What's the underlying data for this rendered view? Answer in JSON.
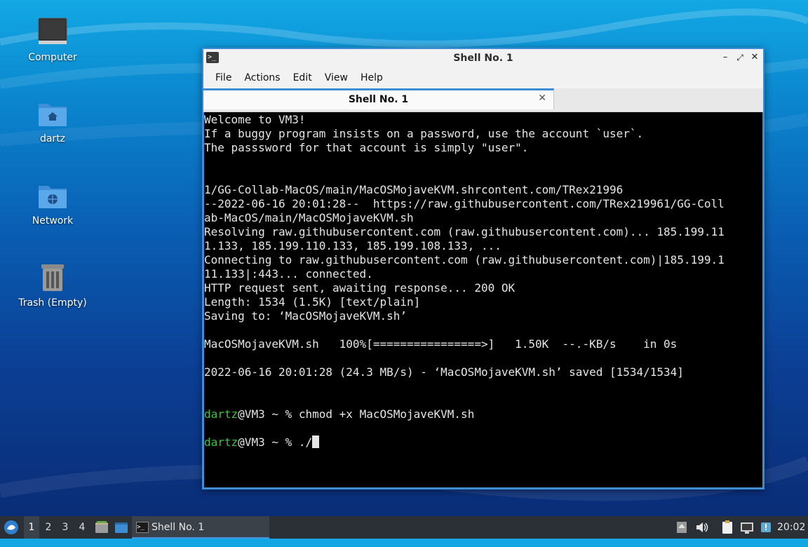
{
  "desktop": {
    "icons": [
      {
        "label": "Computer",
        "icon": "computer-icon"
      },
      {
        "label": "dartz",
        "icon": "home-folder-icon"
      },
      {
        "label": "Network",
        "icon": "network-folder-icon"
      },
      {
        "label": "Trash (Empty)",
        "icon": "trash-icon"
      }
    ]
  },
  "window": {
    "title": "Shell No. 1",
    "icon": "terminal-icon",
    "controls": [
      "minimize",
      "maximize",
      "close"
    ],
    "accent_color": "#3d8cd4"
  },
  "menubar": {
    "items": [
      "File",
      "Actions",
      "Edit",
      "View",
      "Help"
    ]
  },
  "tabs": [
    {
      "label": "Shell No. 1",
      "active": true
    }
  ],
  "terminal": {
    "prompt_user": "dartz",
    "prompt_color": "#3cc13c",
    "lines": [
      "Welcome to VM3!",
      "If a buggy program insists on a password, use the account `user`.",
      "The passsword for that account is simply \"user\".",
      "",
      "",
      "1/GG-Collab-MacOS/main/MacOSMojaveKVM.shrcontent.com/TRex21996",
      "--2022-06-16 20:01:28--  https://raw.githubusercontent.com/TRex219961/GG-Coll",
      "ab-MacOS/main/MacOSMojaveKVM.sh",
      "Resolving raw.githubusercontent.com (raw.githubusercontent.com)... 185.199.11",
      "1.133, 185.199.110.133, 185.199.108.133, ...",
      "Connecting to raw.githubusercontent.com (raw.githubusercontent.com)|185.199.1",
      "11.133|:443... connected.",
      "HTTP request sent, awaiting response... 200 OK",
      "Length: 1534 (1.5K) [text/plain]",
      "Saving to: ‘MacOSMojaveKVM.sh’",
      "",
      "MacOSMojaveKVM.sh   100%[================>]   1.50K  --.-KB/s    in 0s",
      "",
      "2022-06-16 20:01:28 (24.3 MB/s) - ‘MacOSMojaveKVM.sh’ saved [1534/1534]",
      "",
      ""
    ],
    "prompt_lines": [
      {
        "rest": "@VM3 ~ % chmod +x MacOSMojaveKVM.sh"
      },
      {
        "rest": "@VM3 ~ % ./"
      }
    ]
  },
  "taskbar": {
    "start_icon": "lubuntu-menu-icon",
    "workspaces": [
      "1",
      "2",
      "3",
      "4"
    ],
    "active_workspace": "1",
    "quicklaunch": [
      "file-manager-icon",
      "show-desktop-icon"
    ],
    "task": {
      "label": "Shell No. 1",
      "icon": "terminal-icon"
    },
    "tray": [
      "updates-icon",
      "volume-icon",
      "clipboard-icon",
      "network-icon",
      "notification-icon"
    ],
    "clock": "20:02"
  }
}
